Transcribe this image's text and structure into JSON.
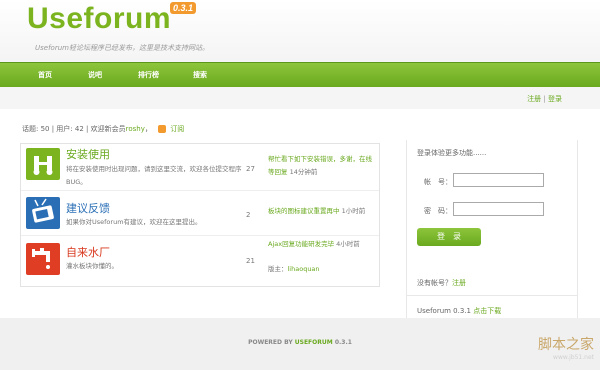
{
  "header": {
    "logo": "Useforum",
    "version": "0.3.1",
    "slogan": "Useforum轻论坛程序已经发布，这里是技术支持网站。"
  },
  "nav": [
    "首页",
    "说吧",
    "排行榜",
    "搜索"
  ],
  "toolbar": {
    "register": "注册",
    "separator": "|",
    "login": "登录"
  },
  "stats": {
    "prefix": "话题: 50 | 用户: 42 | 欢迎新会员",
    "new_user": "roshy",
    "comma": "，",
    "subscribe": "订阅"
  },
  "forums": [
    {
      "title": "安装使用",
      "title_color": "#6aa91f",
      "icon_color": "#7cb420",
      "icon": "hands-icon",
      "desc": "将在安装使用时出现问题，请到这里交流，欢迎各位提交程序BUG。",
      "count": "27",
      "last_title": "帮忙看下如下安装错误，多谢，在线等回复",
      "last_time": "14分钟前",
      "moderator": ""
    },
    {
      "title": "建议反馈",
      "title_color": "#2a6fb6",
      "icon_color": "#2a6fb6",
      "icon": "tv-icon",
      "desc": "如果你对Useforum有建议，欢迎在这里提出。",
      "count": "2",
      "last_title": "板块的图标建议重置再中",
      "last_time": "1小时前",
      "moderator": ""
    },
    {
      "title": "自来水厂",
      "title_color": "#d9381e",
      "icon_color": "#e03d25",
      "icon": "faucet-icon",
      "desc": "灌水板块你懂的。",
      "count": "21",
      "last_title": "Ajax回复功能研发完毕",
      "last_time": "4小时前",
      "moderator_label": "版主：",
      "moderator": "lihaoquan"
    }
  ],
  "login": {
    "hint": "登录体验更多功能......",
    "account_label": "帐　号：",
    "password_label": "密　码：",
    "button": "登　录",
    "no_account": "没有帐号？",
    "register_link": "注册",
    "version_text": "Useforum 0.3.1 ",
    "download": "点击下载"
  },
  "footer": {
    "powered": "POWERED BY ",
    "brand": "USEFORUM",
    "version": " 0.3.1"
  },
  "watermark": {
    "big": "脚本之家",
    "small": "www.jb51.net"
  }
}
